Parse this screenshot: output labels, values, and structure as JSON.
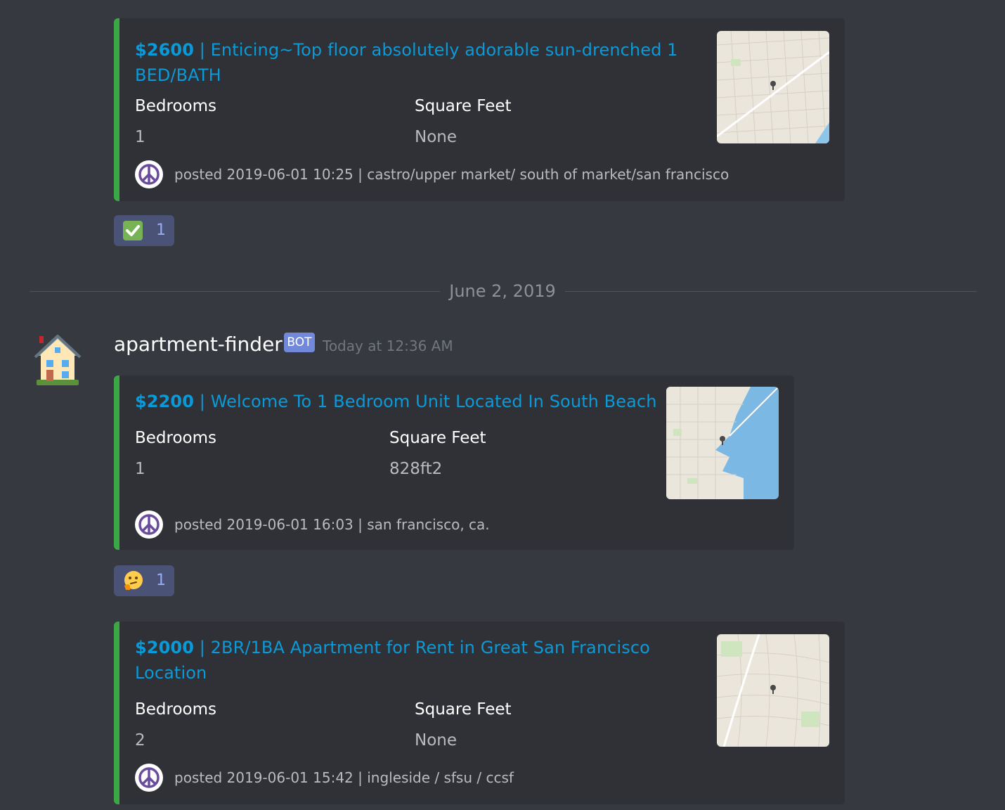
{
  "listings": [
    {
      "price": "$2600",
      "title_rest": " | Enticing~Top floor absolutely adorable sun-drenched 1",
      "title_line2": "BED/BATH",
      "bedrooms_label": "Bedrooms",
      "bedrooms_value": "1",
      "sqft_label": "Square Feet",
      "sqft_value": "None",
      "footer": "posted 2019-06-01 10:25 | castro/upper market/ south of market/san francisco",
      "reaction": {
        "emoji": "check-mark-button-icon",
        "count": "1"
      }
    },
    {
      "price": "$2200",
      "title_rest": " | Welcome To  1 Bedroom Unit Located In South Beach",
      "title_line2": "",
      "bedrooms_label": "Bedrooms",
      "bedrooms_value": "1",
      "sqft_label": "Square Feet",
      "sqft_value": "828ft2",
      "footer": "posted 2019-06-01 16:03 | san francisco, ca.",
      "reaction": {
        "emoji": "thinking-face-icon",
        "count": "1"
      }
    },
    {
      "price": "$2000",
      "title_rest": " | 2BR/1BA Apartment for Rent in Great San Francisco",
      "title_line2": "Location",
      "bedrooms_label": "Bedrooms",
      "bedrooms_value": "2",
      "sqft_label": "Square Feet",
      "sqft_value": "None",
      "footer": "posted 2019-06-01 15:42 | ingleside / sfsu / ccsf"
    }
  ],
  "date_divider": "June 2, 2019",
  "message": {
    "username": "apartment-finder",
    "bot_tag": "BOT",
    "timestamp": "Today at 12:36 AM",
    "avatar": "house-icon"
  },
  "colors": {
    "background": "#36393f",
    "embed_background": "#2f3136",
    "embed_accent": "#3ca845",
    "link": "#0b9ad8",
    "bot_tag": "#7289da",
    "reaction_bg": "#4a5276",
    "reaction_count": "#99aaf5"
  }
}
